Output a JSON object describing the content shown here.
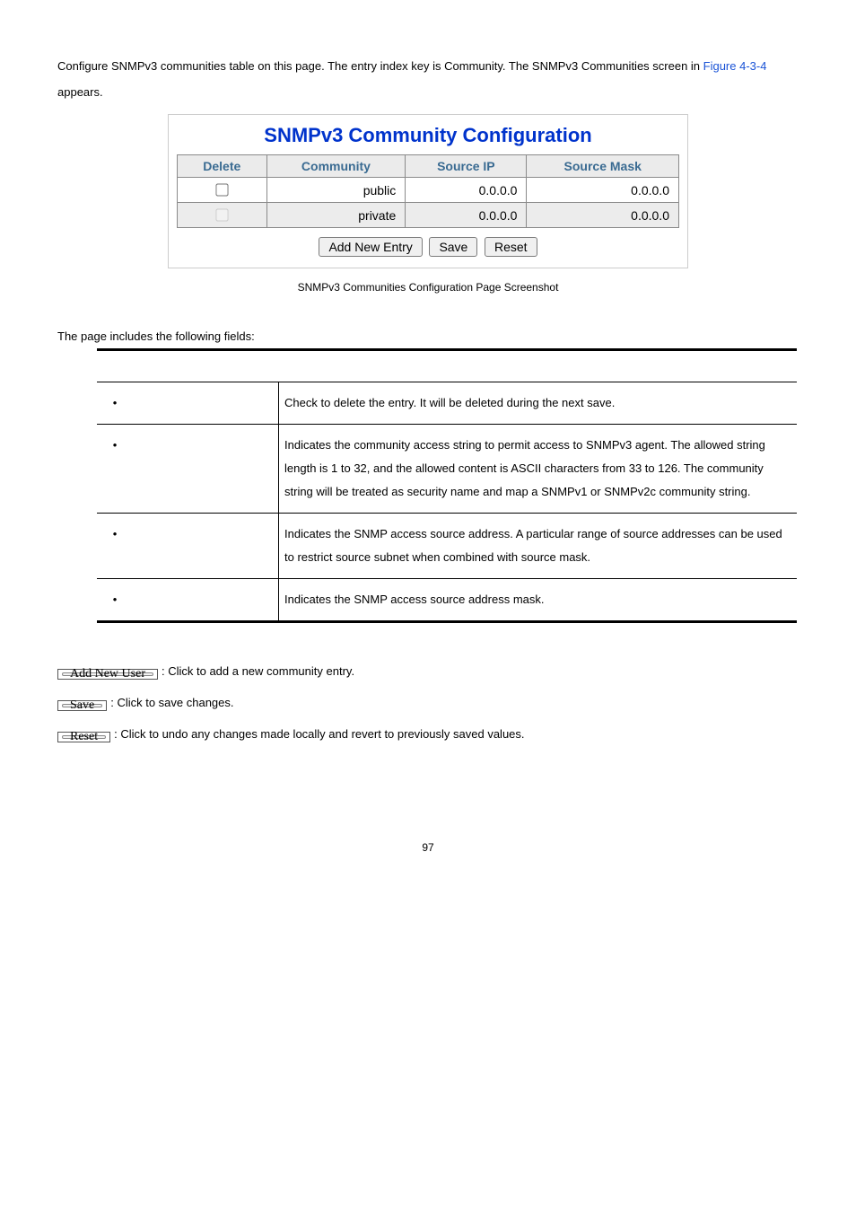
{
  "intro_text_prefix": "Configure SNMPv3 communities table on this page. The entry index key is Community. The SNMPv3 Communities screen in ",
  "intro_link": "Figure 4-3-4",
  "intro_text_suffix": " appears.",
  "figure": {
    "title": "SNMPv3 Community Configuration",
    "headers": {
      "delete": "Delete",
      "community": "Community",
      "source_ip": "Source IP",
      "source_mask": "Source Mask"
    },
    "rows": [
      {
        "community": "public",
        "source_ip": "0.0.0.0",
        "source_mask": "0.0.0.0",
        "checked": false,
        "disabled": false
      },
      {
        "community": "private",
        "source_ip": "0.0.0.0",
        "source_mask": "0.0.0.0",
        "checked": false,
        "disabled": true
      }
    ],
    "buttons": {
      "add": "Add New Entry",
      "save": "Save",
      "reset": "Reset"
    }
  },
  "caption": "SNMPv3 Communities Configuration Page Screenshot",
  "fields_intro": "The page includes the following fields:",
  "fields": [
    {
      "desc": "Check to delete the entry. It will be deleted during the next save."
    },
    {
      "desc": "Indicates the community access string to permit access to SNMPv3 agent. The allowed string length is 1 to 32, and the allowed content is ASCII characters from 33 to 126. The community string will be treated as security name and map a SNMPv1 or SNMPv2c community string."
    },
    {
      "desc": "Indicates the SNMP access source address. A particular range of source addresses can be used to restrict source subnet when combined with source mask."
    },
    {
      "desc": "Indicates the SNMP access source address mask."
    }
  ],
  "button_descs": {
    "add_user": {
      "label": "Add New User",
      "text": ": Click to add a new community entry."
    },
    "save": {
      "label": "Save",
      "text": ": Click to save changes."
    },
    "reset": {
      "label": "Reset",
      "text": ": Click to undo any changes made locally and revert to previously saved values."
    }
  },
  "page_number": "97"
}
